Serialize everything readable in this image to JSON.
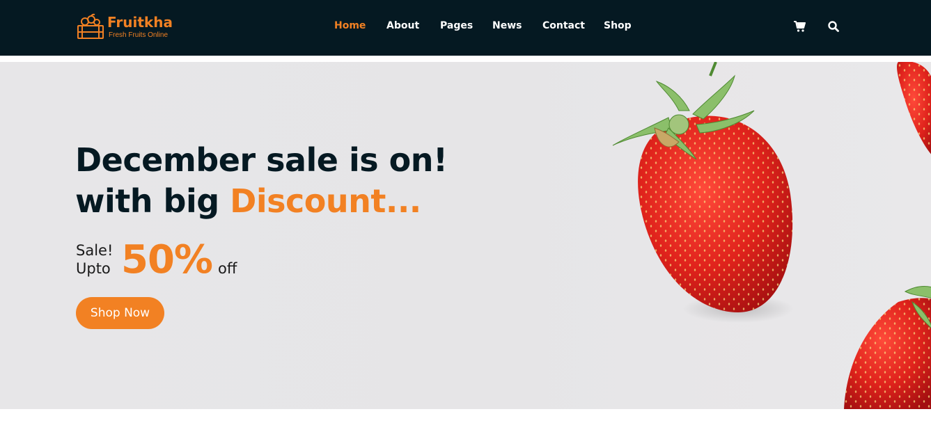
{
  "brand": {
    "name": "Fruitkha",
    "tagline": "Fresh Fruits Online",
    "accent_color": "#F28123",
    "dark_color": "#051922"
  },
  "nav": {
    "items": [
      {
        "label": "Home",
        "active": true
      },
      {
        "label": "About",
        "active": false
      },
      {
        "label": "Pages",
        "active": false
      },
      {
        "label": "News",
        "active": false
      },
      {
        "label": "Contact",
        "active": false
      },
      {
        "label": "Shop",
        "active": false
      }
    ],
    "icons": [
      "shopping-cart-icon",
      "search-icon"
    ]
  },
  "hero": {
    "headline_line1": "December sale is on!",
    "headline_line2_prefix": "with big ",
    "headline_line2_accent": "Discount...",
    "sale_label": "Sale!",
    "upto_label": "Upto",
    "discount_value": "50%",
    "off_label": "off",
    "cta_label": "Shop Now",
    "image": "strawberries"
  }
}
